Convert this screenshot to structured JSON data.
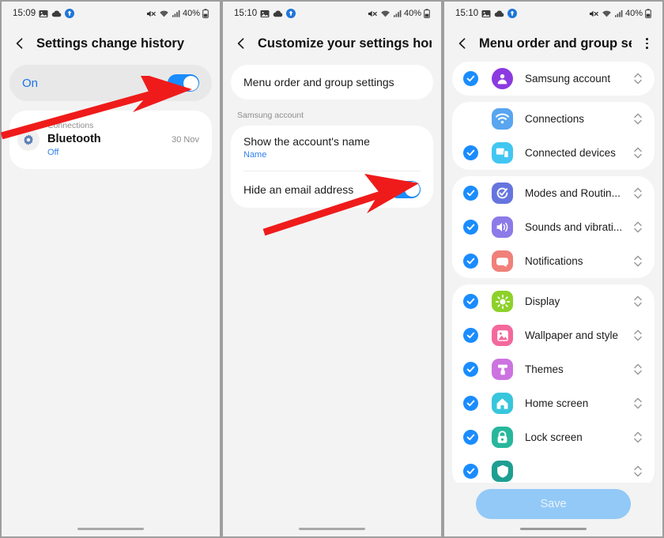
{
  "panels": [
    {
      "id": "settings-change-history",
      "status": {
        "time": "15:09",
        "battery": "40%"
      },
      "header": {
        "title": "Settings change history",
        "back_icon": "back-chevron-icon"
      },
      "toggle_row": {
        "label": "On",
        "state": "on"
      },
      "history": [
        {
          "category": "Connections",
          "title": "Bluetooth",
          "state": "Off",
          "date": "30 Nov",
          "icon": "gear-icon"
        }
      ]
    },
    {
      "id": "customize-settings-home",
      "status": {
        "time": "15:10",
        "battery": "40%"
      },
      "header": {
        "title": "Customize your settings home",
        "back_icon": "back-chevron-icon"
      },
      "menu_order_item": "Menu order and group settings",
      "section_label": "Samsung account",
      "rows": [
        {
          "title": "Show the account's name",
          "subtitle": "Name",
          "type": "value"
        },
        {
          "title": "Hide an email address",
          "type": "toggle",
          "state": "on"
        }
      ]
    },
    {
      "id": "menu-order-group-settings",
      "status": {
        "time": "15:10",
        "battery": "40%"
      },
      "header": {
        "title": "Menu order and group se...",
        "back_icon": "back-chevron-icon",
        "overflow_icon": "kebab-menu-icon"
      },
      "save_label": "Save",
      "groups": [
        {
          "items": [
            {
              "label": "Samsung account",
              "checked": true,
              "icon": "person-icon",
              "color": "#8b3ae0",
              "shape": "round"
            }
          ]
        },
        {
          "items": [
            {
              "label": "Connections",
              "checked": false,
              "icon": "wifi-icon",
              "color": "#58a5f0",
              "shape": "squircle"
            },
            {
              "label": "Connected devices",
              "checked": true,
              "icon": "devices-icon",
              "color": "#41c6f2",
              "shape": "squircle"
            }
          ]
        },
        {
          "items": [
            {
              "label": "Modes and Routin...",
              "checked": true,
              "icon": "modes-icon",
              "color": "#6675de",
              "shape": "squircle"
            },
            {
              "label": "Sounds and vibrati...",
              "checked": true,
              "icon": "sound-icon",
              "color": "#8b7ae8",
              "shape": "squircle"
            },
            {
              "label": "Notifications",
              "checked": true,
              "icon": "notifications-icon",
              "color": "#f0807a",
              "shape": "squircle"
            }
          ]
        },
        {
          "items": [
            {
              "label": "Display",
              "checked": true,
              "icon": "brightness-icon",
              "color": "#8dd12a",
              "shape": "squircle"
            },
            {
              "label": "Wallpaper and style",
              "checked": true,
              "icon": "wallpaper-icon",
              "color": "#f4689c",
              "shape": "squircle"
            },
            {
              "label": "Themes",
              "checked": true,
              "icon": "themes-icon",
              "color": "#cc73e0",
              "shape": "squircle"
            },
            {
              "label": "Home screen",
              "checked": true,
              "icon": "home-icon",
              "color": "#38c6dc",
              "shape": "squircle"
            },
            {
              "label": "Lock screen",
              "checked": true,
              "icon": "lock-icon",
              "color": "#27b79c",
              "shape": "squircle"
            },
            {
              "label": "",
              "checked": true,
              "icon": "security-icon",
              "color": "#1e9f91",
              "shape": "squircle",
              "clipped": true
            }
          ]
        }
      ]
    }
  ],
  "annotations": {
    "arrow_color": "#ef1b1b",
    "arrows": [
      {
        "target": "history-toggle-switch"
      },
      {
        "target": "hide-email-toggle-switch"
      }
    ]
  }
}
